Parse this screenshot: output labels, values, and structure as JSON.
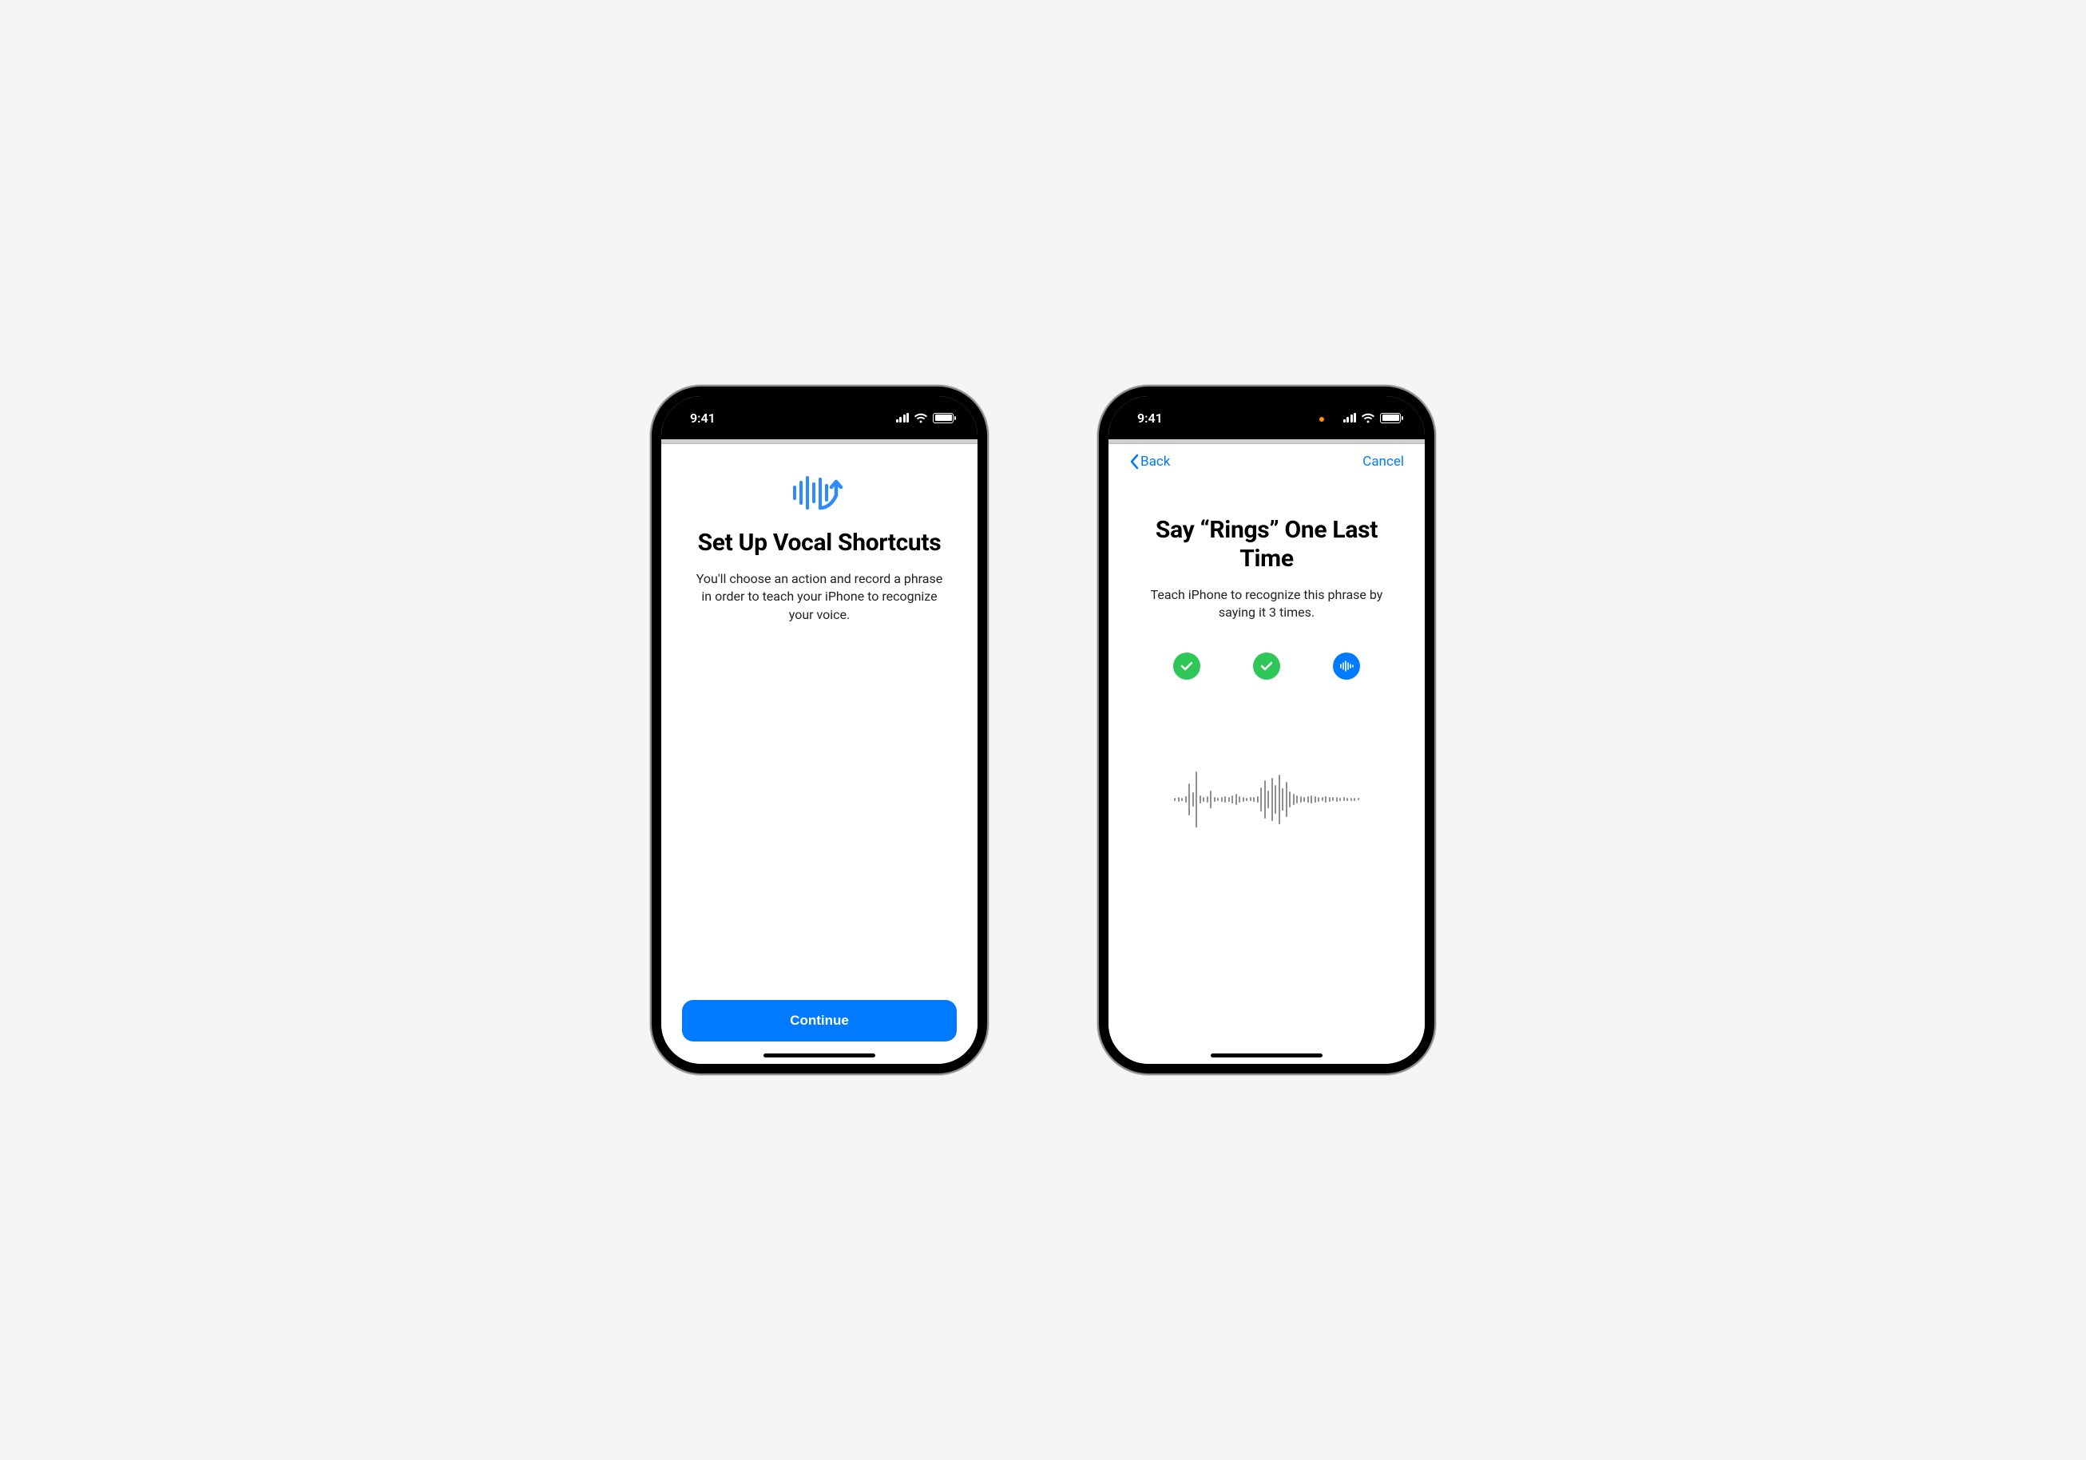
{
  "status_bar": {
    "time": "9:41"
  },
  "phone1": {
    "title": "Set Up Vocal Shortcuts",
    "subtitle": "You'll choose an action and record a phrase in order to teach your iPhone to recognize your voice.",
    "continue_label": "Continue"
  },
  "phone2": {
    "back_label": "Back",
    "cancel_label": "Cancel",
    "title": "Say “Rings” One Last Time",
    "subtitle": "Teach iPhone to recognize this phrase by saying it 3 times.",
    "progress": [
      {
        "state": "done"
      },
      {
        "state": "done"
      },
      {
        "state": "recording"
      }
    ]
  }
}
